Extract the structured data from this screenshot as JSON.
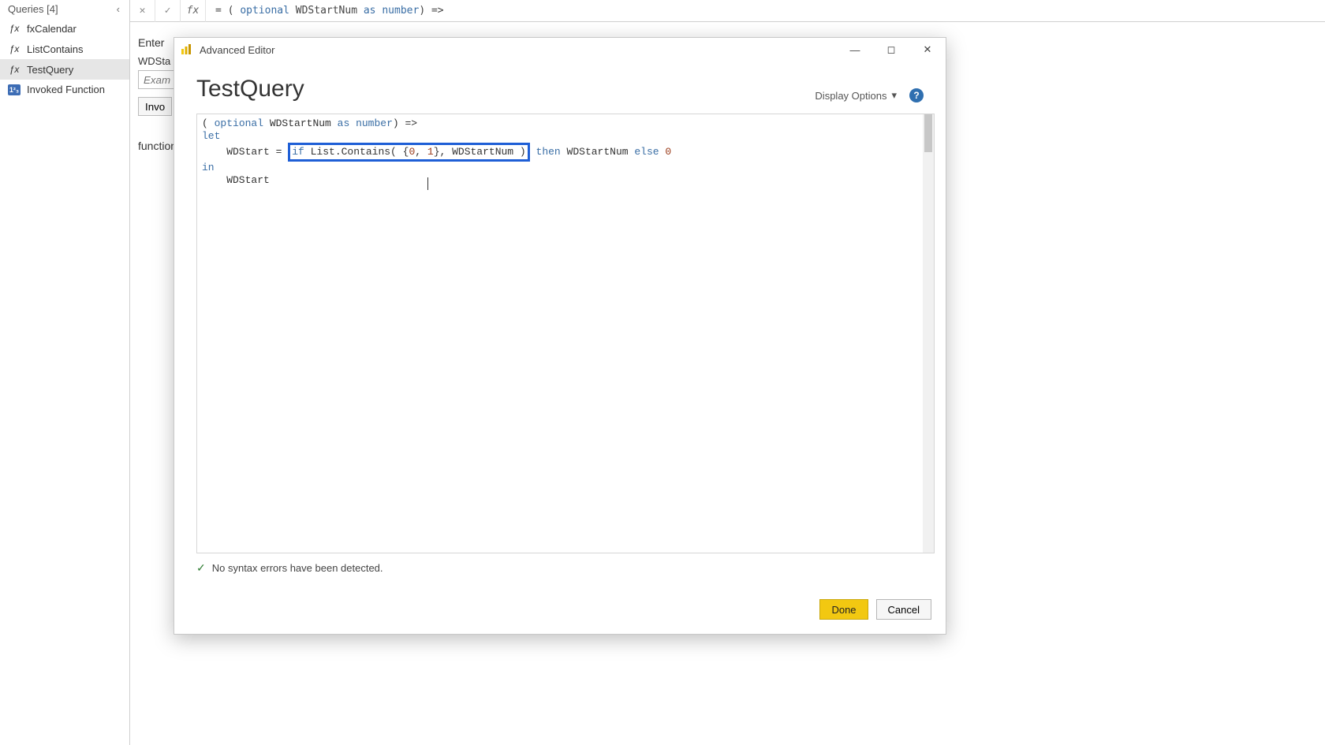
{
  "queries": {
    "header": "Queries [4]",
    "collapse_glyph": "‹",
    "items": [
      {
        "icon": "fx",
        "label": "fxCalendar"
      },
      {
        "icon": "fx",
        "label": "ListContains"
      },
      {
        "icon": "fx",
        "label": "TestQuery",
        "selected": true
      },
      {
        "icon": "num",
        "label": "Invoked Function"
      }
    ]
  },
  "formula_bar": {
    "cancel_glyph": "✕",
    "accept_glyph": "✓",
    "fx_label": "fx",
    "prefix": "= ( ",
    "kw_optional": "optional",
    "ident": " WDStartNum ",
    "kw_as": "as",
    "space": " ",
    "kw_number": "number",
    "suffix": ") =>"
  },
  "back": {
    "enter_label": "Enter",
    "param_label": "WDSta",
    "input_placeholder": "Exam",
    "invoke_btn": "Invo",
    "function_label": "function"
  },
  "dialog": {
    "title": "Advanced Editor",
    "minimize_glyph": "—",
    "maximize_glyph": "◻",
    "close_glyph": "✕",
    "query_name": "TestQuery",
    "display_options": "Display Options",
    "display_caret": "▾",
    "help_glyph": "?",
    "code": {
      "line1": {
        "a": "( ",
        "kw_optional": "optional",
        "b": " WDStartNum ",
        "kw_as": "as",
        "c": " ",
        "kw_number": "number",
        "d": ") =>"
      },
      "line2": {
        "kw_let": "let"
      },
      "line3": {
        "indent": "    WDStart = ",
        "hl_if": "if",
        "hl_mid": " List.Contains( {",
        "hl_n0": "0",
        "hl_c1": ", ",
        "hl_n1": "1",
        "hl_c2": "}, WDStartNum )",
        "after_sp": " ",
        "kw_then": "then",
        "after_then": " WDStartNum ",
        "kw_else": "else",
        "sp2": " ",
        "zero": "0"
      },
      "line4": {
        "kw_in": "in"
      },
      "line5": {
        "indent": "    WDStart"
      }
    },
    "status": {
      "icon": "✓",
      "text": "No syntax errors have been detected."
    },
    "buttons": {
      "done": "Done",
      "cancel": "Cancel"
    }
  }
}
